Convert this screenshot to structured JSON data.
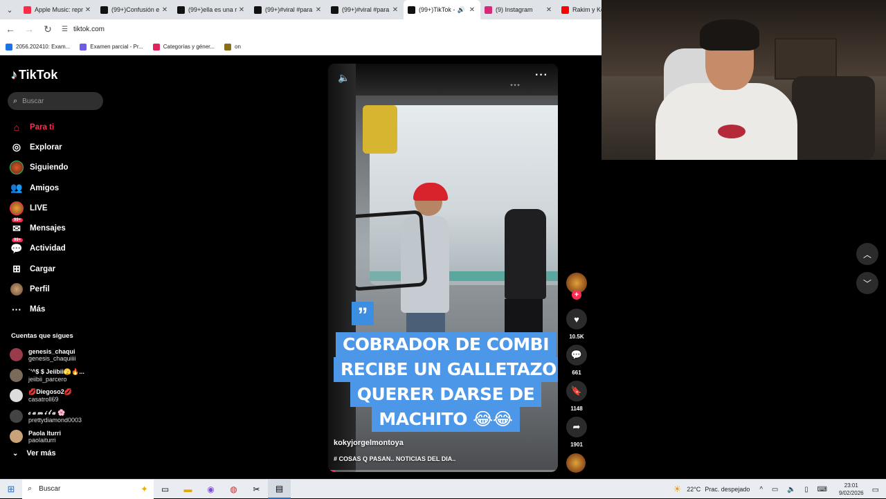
{
  "browser": {
    "tabs": [
      {
        "label": "Apple Music: repr",
        "fav_color": "#fa2d48",
        "active": false
      },
      {
        "label": "(99+)Confusión e",
        "fav_color": "#111111",
        "active": false
      },
      {
        "label": "(99+)ella es una r",
        "fav_color": "#111111",
        "active": false
      },
      {
        "label": "(99+)#viral #para",
        "fav_color": "#111111",
        "active": false
      },
      {
        "label": "(99+)#viral #para",
        "fav_color": "#111111",
        "active": false
      },
      {
        "label": "(99+)TikTok -",
        "fav_color": "#111111",
        "active": true
      },
      {
        "label": "(9) Instagram",
        "fav_color": "#d6297a",
        "active": false
      },
      {
        "label": "Rakim y Ken",
        "fav_color": "#ff0000",
        "active": false
      }
    ],
    "url": "tiktok.com",
    "bookmarks": [
      {
        "label": "2056.202410: Exam...",
        "color": "#1a73e8"
      },
      {
        "label": "Examen parcial - Pr...",
        "color": "#6c5ce7"
      },
      {
        "label": "Categorías y géner...",
        "color": "#e0245e"
      },
      {
        "label": "on",
        "color": "#8a6d1a"
      }
    ]
  },
  "tiktok": {
    "logo": "TikTok",
    "search_placeholder": "Buscar",
    "menu": [
      {
        "label": "Para ti",
        "icon": "home-icon",
        "glyph": "⌂",
        "active": true
      },
      {
        "label": "Explorar",
        "icon": "compass-icon",
        "glyph": "◎",
        "active": false
      },
      {
        "label": "Siguiendo",
        "icon": "following-avatar",
        "glyph": "",
        "active": false
      },
      {
        "label": "Amigos",
        "icon": "friends-icon",
        "glyph": "👥",
        "active": false
      },
      {
        "label": "LIVE",
        "icon": "live-avatar",
        "glyph": "",
        "active": false
      },
      {
        "label": "Mensajes",
        "icon": "messages-icon",
        "glyph": "✉",
        "active": false,
        "badge": "99+"
      },
      {
        "label": "Actividad",
        "icon": "activity-icon",
        "glyph": "💬",
        "active": false,
        "badge": "99+"
      },
      {
        "label": "Cargar",
        "icon": "upload-icon",
        "glyph": "⊞",
        "active": false
      },
      {
        "label": "Perfil",
        "icon": "profile-avatar",
        "glyph": "",
        "active": false
      },
      {
        "label": "Más",
        "icon": "more-icon",
        "glyph": "···",
        "active": false
      }
    ],
    "following_title": "Cuentas que sigues",
    "following": [
      {
        "name": "genesis_chaqui",
        "user": "genesis_chaquiiii",
        "color": "#9a3b4b"
      },
      {
        "name": "`'^$ $ Jeiibii🫣🔥...",
        "user": "jeiibii_parcero",
        "color": "#7a6a5a"
      },
      {
        "name": "💋Diegoso2💋",
        "user": "casatroll69",
        "color": "#dddddd"
      },
      {
        "name": "𝒸 𝒶 𝓂 𝒾 𝓁 𝒶 🌸",
        "user": "prettydiamond0003",
        "color": "#444444"
      },
      {
        "name": "Paola Iturri",
        "user": "paolaiturri",
        "color": "#c9a27a"
      }
    ],
    "ver_mas": "Ver más"
  },
  "video": {
    "caption_lines": [
      "COBRADOR DE COMBI",
      "RECIBE UN GALLETAZO AL",
      "QUERER DARSE DE",
      "MACHITO 😂😂"
    ],
    "author": "kokyjorgelmontoya",
    "description": "# COSAS Q PASAN.. NOTICIAS DEL DIA..",
    "progress": 0.03,
    "likes": "10.5K",
    "comments": "661",
    "saves": "1148",
    "shares": "1901"
  },
  "taskbar": {
    "search": "Buscar",
    "temperature": "22°C",
    "weather": "Prac. despejado",
    "time": "23:01",
    "date": "9/02/2026"
  }
}
